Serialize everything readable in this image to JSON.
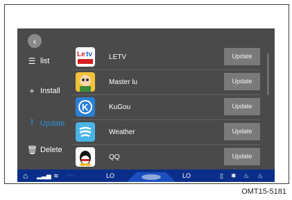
{
  "nav": {
    "back_icon": "back-arrow-icon",
    "items": [
      {
        "label": "list",
        "icon": "list-icon"
      },
      {
        "label": "Install",
        "icon": "plus-icon"
      },
      {
        "label": "Update",
        "icon": "upload-icon",
        "active": true
      },
      {
        "label": "Delete",
        "icon": "trash-icon"
      }
    ]
  },
  "apps": [
    {
      "name": "LETV",
      "action": "Update",
      "icon": "letv-app-icon"
    },
    {
      "name": "Master lu",
      "action": "Update",
      "icon": "master-lu-app-icon"
    },
    {
      "name": "KuGou",
      "action": "Update",
      "icon": "kugou-app-icon"
    },
    {
      "name": "Weather",
      "action": "Update",
      "icon": "weather-app-icon"
    },
    {
      "name": "QQ",
      "action": "Update",
      "icon": "qq-app-icon"
    }
  ],
  "status_bar": {
    "temp_left": "LO",
    "temp_right": "LO",
    "icons": [
      "home-icon",
      "signal-icon",
      "defrost-icon",
      "fan-icon",
      "phone-icon",
      "bluetooth-icon",
      "seat-heat-left-icon",
      "seat-heat-right-icon"
    ]
  },
  "caption": "OMT15-5181",
  "colors": {
    "screen_bg": "#4a4a4a",
    "status_bar": "#0a2f8a",
    "active": "#2f8fd9",
    "button": "#7a7a7a"
  }
}
